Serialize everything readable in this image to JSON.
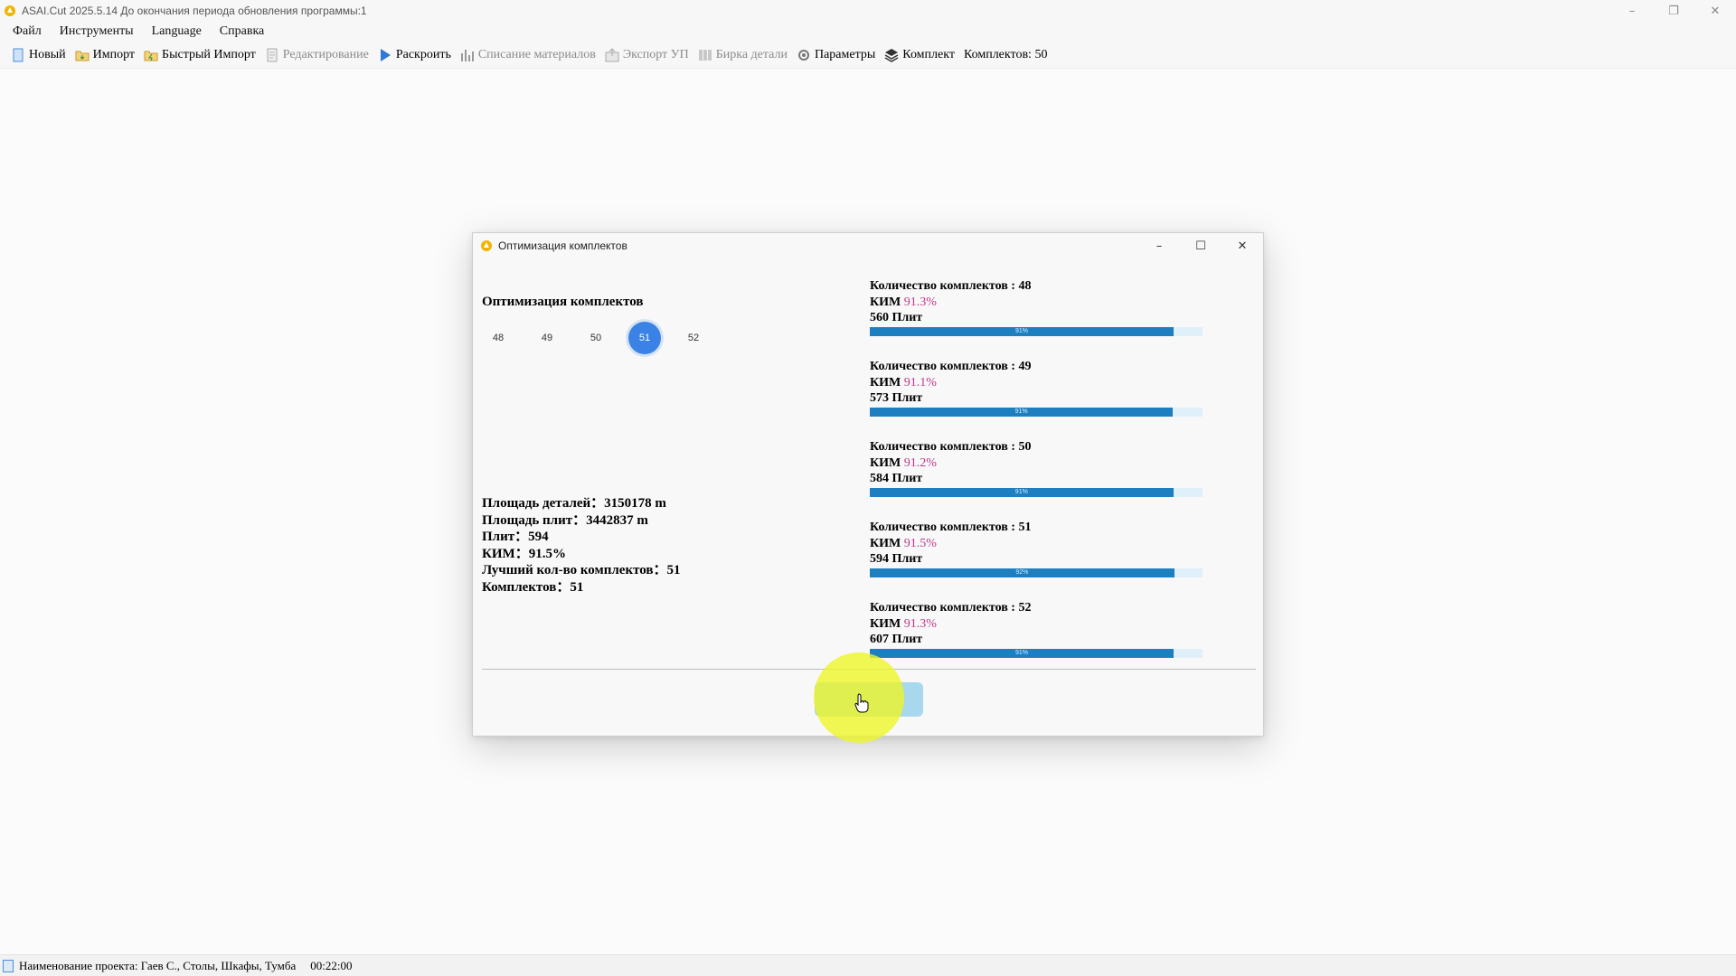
{
  "window": {
    "title": "ASAI.Cut  2025.5.14  До окончания периода обновления программы:1",
    "minimize": "–",
    "restore": "❐",
    "close": "✕"
  },
  "menu": {
    "items": [
      "Файл",
      "Инструменты",
      "Language",
      "Справка"
    ]
  },
  "toolbar": {
    "new": "Новый",
    "import": "Импорт",
    "quick_import": "Быстрый Импорт",
    "edit": "Редактирование",
    "cut": "Раскроить",
    "write_off": "Списание материалов",
    "export": "Экспорт УП",
    "label": "Бирка детали",
    "params": "Параметры",
    "kit": "Комплект",
    "kits_count": "Комплектов: 50"
  },
  "statusbar": {
    "project": "Наименование проекта: Гаев С., Столы, Шкафы, Тумба",
    "time": "00:22:00"
  },
  "dialog": {
    "title": "Оптимизация комплектов",
    "heading": "Оптимизация комплектов",
    "minimize": "–",
    "maximize": "☐",
    "close": "✕",
    "pages": [
      "48",
      "49",
      "50",
      "51",
      "52"
    ],
    "active_page": "51",
    "summary": {
      "details_area": "Площадь деталей：3150178 m",
      "sheets_area": "Площадь плит：3442837 m",
      "sheets": "Плит：594",
      "kim": "КИМ：91.5%",
      "best_kits": "Лучший кол-во комплектов：51",
      "kits": "Комплектов：51"
    },
    "results": [
      {
        "count_label": "Количество комплектов : 48",
        "kim_label": "КИМ",
        "kim_value": "91.3%",
        "sheets_label": "560  Плит",
        "progress": 0.913,
        "progress_text": "91%"
      },
      {
        "count_label": "Количество комплектов : 49",
        "kim_label": "КИМ",
        "kim_value": "91.1%",
        "sheets_label": "573  Плит",
        "progress": 0.911,
        "progress_text": "91%"
      },
      {
        "count_label": "Количество комплектов : 50",
        "kim_label": "КИМ",
        "kim_value": "91.2%",
        "sheets_label": "584  Плит",
        "progress": 0.912,
        "progress_text": "91%"
      },
      {
        "count_label": "Количество комплектов : 51",
        "kim_label": "КИМ",
        "kim_value": "91.5%",
        "sheets_label": "594  Плит",
        "progress": 0.915,
        "progress_text": "92%"
      },
      {
        "count_label": "Количество комплектов : 52",
        "kim_label": "КИМ",
        "kim_value": "91.3%",
        "sheets_label": "607  Плит",
        "progress": 0.913,
        "progress_text": "91%"
      }
    ]
  },
  "colors": {
    "accent": "#3a82e6",
    "progress_fill": "#1e7fc0",
    "progress_track": "#dff0fa",
    "kim_value": "#c2378c",
    "ok_button": "#a8d8ee"
  }
}
